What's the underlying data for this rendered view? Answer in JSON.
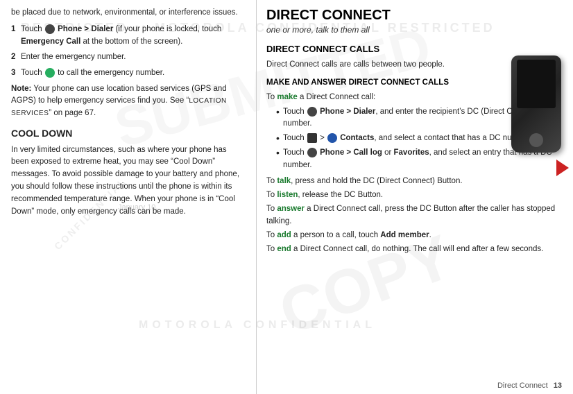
{
  "watermarks": {
    "restricted": "RESTRICTED :: MOTOROLA CONFIDENTIAL RESTRICTED",
    "copy": "COPY",
    "submit": "SUBMITTED",
    "motorola": "MOTOROLA CONFIDENTIAL",
    "confidential": "CONFIDENTIAL"
  },
  "left": {
    "intro": "be placed due to network, environmental, or interference issues.",
    "steps": [
      {
        "num": "1",
        "text": "Touch",
        "icon": "phone",
        "bold": "Phone > Dialer",
        "rest": " (if your phone is locked, touch ",
        "bold2": "Emergency Call",
        "rest2": " at the bottom of the screen)."
      },
      {
        "num": "2",
        "text": "Enter the emergency number."
      },
      {
        "num": "3",
        "text": "Touch",
        "icon": "call",
        "rest": " to call the emergency number."
      }
    ],
    "note_label": "Note:",
    "note_text": " Your phone can use location based services (GPS and AGPS) to help emergency services find you. See “",
    "note_link": "LOCATION SERVICES",
    "note_end": "” on page 67.",
    "cool_down_title": "COOL DOWN",
    "cool_down_text": "In very limited circumstances, such as where your phone has been exposed to extreme heat, you may see “Cool Down” messages. To avoid possible damage to your battery and phone, you should follow these instructions until the phone is within its recommended temperature range. When your phone is in “Cool Down” mode, only emergency calls can be made.",
    "date_watermark": "January 10,"
  },
  "right": {
    "main_title": "DIRECT CONNECT",
    "subtitle": "one or more, talk to them all",
    "calls_title": "DIRECT CONNECT CALLS",
    "calls_body": "Direct Connect calls are calls between two people.",
    "make_title": "MAKE AND ANSWER DIRECT CONNECT CALLS",
    "make_intro": "To make a Direct Connect call:",
    "make_word": "make",
    "bullets": [
      {
        "text_pre": "Touch",
        "icon": "phone",
        "bold": "Phone > Dialer",
        "text_rest": ", and enter the recipient’s DC (Direct Connect) number."
      },
      {
        "text_pre": "Touch",
        "icon": "contacts",
        "bold": "> Contacts",
        "text_rest": ", and select a contact that has a DC number."
      },
      {
        "text_pre": "Touch",
        "icon": "phone",
        "bold": "Phone > Call log",
        "text_rest": " or ",
        "bold2": "Favorites",
        "text_rest2": ", and select an entry that has a DC number."
      }
    ],
    "talk_line": {
      "pre": "To ",
      "word": "talk",
      "rest": ", press and hold the DC (Direct Connect) Button."
    },
    "listen_line": {
      "pre": "To ",
      "word": "listen",
      "rest": ", release the DC Button."
    },
    "answer_line": {
      "pre": "To ",
      "word": "answer",
      "rest": " a Direct Connect call, press the DC Button after the caller has stopped talking."
    },
    "add_line": {
      "pre": "To ",
      "word": "add",
      "rest": " a person to a call, touch ",
      "bold": "Add member",
      "end": "."
    },
    "end_line": {
      "pre": "To ",
      "word": "end",
      "rest": " a Direct Connect call, do nothing. The call will end after a few seconds."
    }
  },
  "footer": {
    "section": "Direct Connect",
    "page": "13"
  }
}
